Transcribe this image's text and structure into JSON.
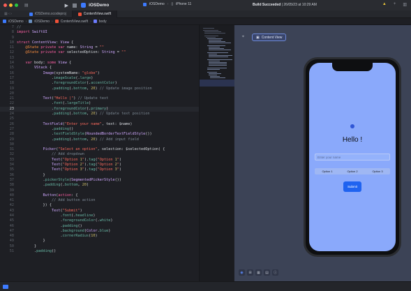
{
  "toolbar": {
    "app_name": "iOSDemo",
    "scheme_target": "iOSDemo",
    "scheme_device": "iPhone 11",
    "build_status": "Build Succeeded",
    "build_time": "26/05/23 at 10:29 AM"
  },
  "tabs": [
    {
      "label": "iOSDemo.xcodeproj"
    },
    {
      "label": "ContentView.swift"
    }
  ],
  "breadcrumb": [
    "iOSDemo",
    "iOSDemo",
    "ContentView.swift",
    "body"
  ],
  "editor": {
    "current_line": "23",
    "line_numbers": [
      "7",
      "8",
      "9",
      "10",
      "11",
      "12",
      "13",
      "14",
      "15",
      "16",
      "17",
      "18",
      "19",
      "20",
      "21",
      "22",
      "23",
      "24",
      "25",
      "26",
      "27",
      "28",
      "29",
      "30",
      "31",
      "32",
      "33",
      "34",
      "35",
      "36",
      "37",
      "38",
      "39",
      "40",
      "41",
      "42",
      "43",
      "44",
      "45",
      "46",
      "47",
      "48",
      "49",
      "50",
      "51"
    ],
    "code_lines": [
      "//",
      "import SwiftUI",
      "",
      "struct ContentView: View {",
      "    @State private var name: String = \"\"",
      "    @State private var selectedOption: String = \"\"",
      "",
      "    var body: some View {",
      "        VStack {",
      "            Image(systemName: \"globe\")",
      "                .imageScale(.large)",
      "                .foregroundColor(.accentColor)",
      "                .padding(.bottom, 20) // Update image position",
      "",
      "            Text(\"Hello |\") // Update text",
      "                .font(.largeTitle)",
      "                .foregroundColor(.primary)",
      "                .padding(.bottom, 20) // Update text position",
      "",
      "            TextField(\"Enter your name\", text: $name)",
      "                .padding()",
      "                .textFieldStyle(RoundedBorderTextFieldStyle())",
      "                .padding(.bottom, 20) // Add input field",
      "",
      "            Picker(\"Select an option\", selection: $selectedOption) {",
      "                // Add dropdown",
      "                Text(\"Option 1\").tag(\"Option 1\")",
      "                Text(\"Option 2\").tag(\"Option 2\")",
      "                Text(\"Option 3\").tag(\"Option 3\")",
      "            }",
      "            .pickerStyle(SegmentedPickerStyle())",
      "            .padding(.bottom, 20)",
      "",
      "            Button(action: {",
      "                // Add button action",
      "            }) {",
      "                Text(\"Submit\")",
      "                    .font(.headline)",
      "                    .foregroundColor(.white)",
      "                    .padding()",
      "                    .background(Color.blue)",
      "                    .cornerRadius(10)",
      "            }",
      "        }",
      "        .padding()",
      "    }",
      "}"
    ]
  },
  "canvas": {
    "badge_label": "Content View",
    "preview": {
      "hello_text": "Hello !",
      "name_placeholder": "Enter your name",
      "options": [
        "Option 1",
        "Option 2",
        "Option 3"
      ],
      "submit_label": "Submit"
    }
  },
  "colors": {
    "accent": "#3d7bff",
    "preview_bg": "#8aa9fb",
    "submit_bg": "#1f63f0"
  }
}
